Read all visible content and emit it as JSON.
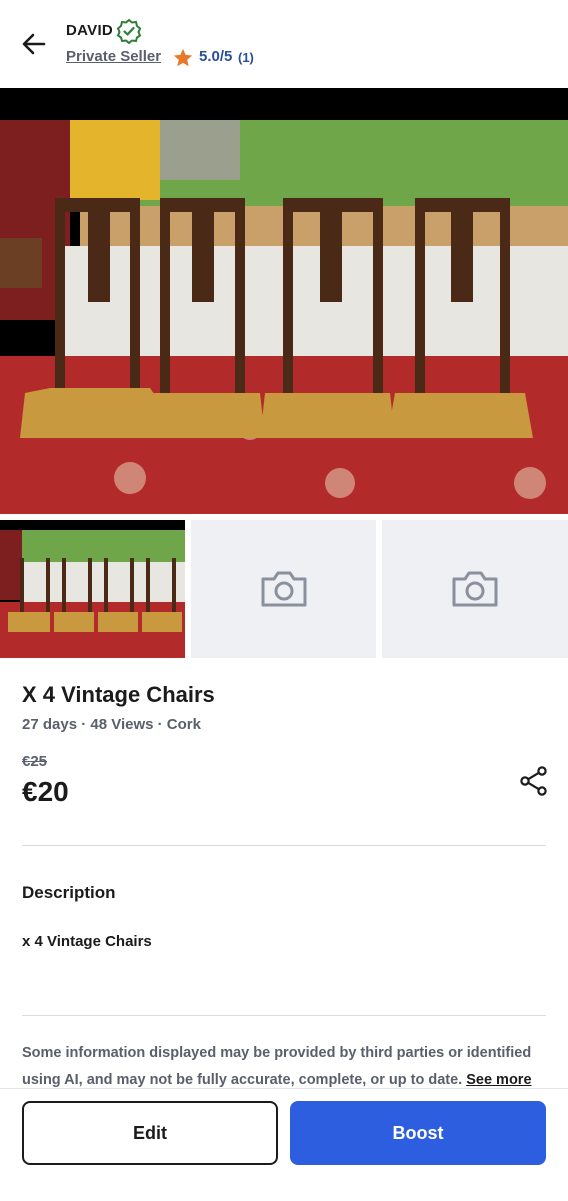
{
  "header": {
    "seller_name": "DAVID",
    "seller_type": "Private Seller",
    "rating_value": "5.0/5",
    "rating_count": "(1)"
  },
  "listing": {
    "title": "X 4 Vintage Chairs",
    "meta": "27 days · 48 Views · Cork",
    "old_price": "€25",
    "price": "€20"
  },
  "description": {
    "heading": "Description",
    "text": "x 4 Vintage Chairs"
  },
  "disclaimer": {
    "text": "Some information displayed may be provided by third parties or identified using AI, and may not be fully accurate, complete, or up to date.",
    "see_more": "See more"
  },
  "actions": {
    "edit_label": "Edit",
    "boost_label": "Boost"
  },
  "colors": {
    "accent": "#2e5ee0",
    "rating_star": "#e8782a",
    "verified": "#2f7d3a"
  },
  "icons": {
    "back": "arrow-left-icon",
    "verified": "verified-badge-icon",
    "star": "star-icon",
    "share": "share-icon",
    "camera": "camera-icon"
  }
}
